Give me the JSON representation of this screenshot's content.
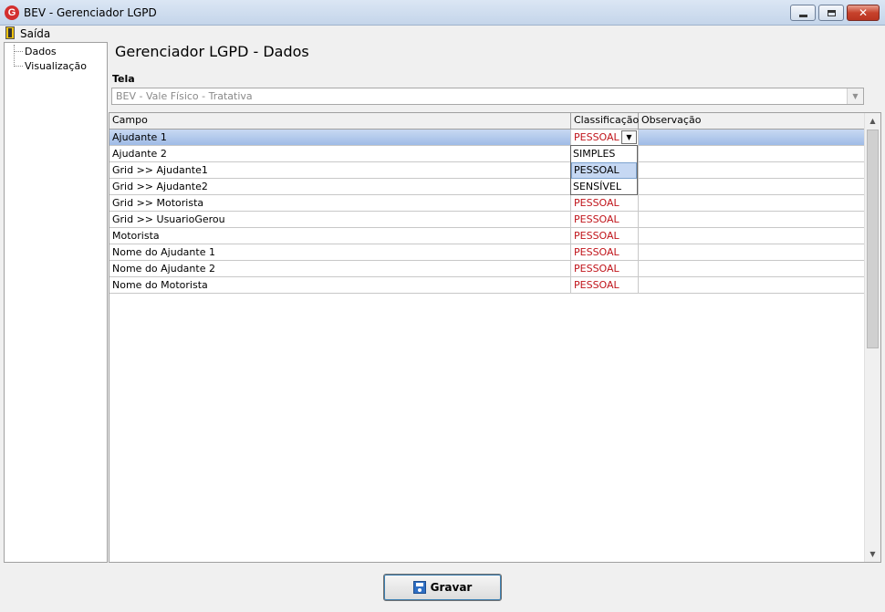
{
  "window": {
    "title": "BEV - Gerenciador LGPD",
    "icon": "app-logo-icon",
    "close_glyph": "✕"
  },
  "menu": {
    "exit_label": "Saída"
  },
  "tree": {
    "items": [
      {
        "label": "Dados"
      },
      {
        "label": "Visualização"
      }
    ]
  },
  "main": {
    "title": "Gerenciador LGPD - Dados",
    "tela_label": "Tela",
    "tela_value": "BEV - Vale Físico - Tratativa"
  },
  "grid": {
    "columns": [
      "Campo",
      "Classificação",
      "Observação"
    ],
    "rows": [
      {
        "campo": "Ajudante 1",
        "classificacao": "PESSOAL",
        "observacao": ""
      },
      {
        "campo": "Ajudante 2",
        "classificacao": "",
        "observacao": ""
      },
      {
        "campo": "Grid >> Ajudante1",
        "classificacao": "",
        "observacao": ""
      },
      {
        "campo": "Grid >> Ajudante2",
        "classificacao": "",
        "observacao": ""
      },
      {
        "campo": "Grid >> Motorista",
        "classificacao": "PESSOAL",
        "observacao": ""
      },
      {
        "campo": "Grid >> UsuarioGerou",
        "classificacao": "PESSOAL",
        "observacao": ""
      },
      {
        "campo": "Motorista",
        "classificacao": "PESSOAL",
        "observacao": ""
      },
      {
        "campo": "Nome do Ajudante 1",
        "classificacao": "PESSOAL",
        "observacao": ""
      },
      {
        "campo": "Nome do Ajudante 2",
        "classificacao": "PESSOAL",
        "observacao": ""
      },
      {
        "campo": "Nome do Motorista",
        "classificacao": "PESSOAL",
        "observacao": ""
      }
    ],
    "selected_row": 0,
    "dropdown_options": [
      "SIMPLES",
      "PESSOAL",
      "SENSÍVEL"
    ],
    "dropdown_highlighted": 1
  },
  "footer": {
    "save_label": "Gravar"
  },
  "colors": {
    "classification_text": "#c0141a",
    "selected_row": "#9fbbe6"
  }
}
